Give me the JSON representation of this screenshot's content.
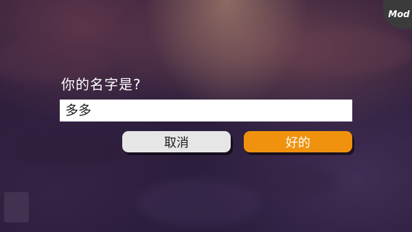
{
  "mod_badge": {
    "label": "Mod"
  },
  "dialog": {
    "prompt": "你的名字是?",
    "name_input": {
      "value": "多多",
      "placeholder": ""
    },
    "cancel_label": "取消",
    "ok_label": "好的"
  },
  "colors": {
    "ok_button": "#f0920e",
    "cancel_button": "#e6e6e6",
    "input_background": "#ffffff",
    "mod_badge": "#3b3b3b"
  }
}
